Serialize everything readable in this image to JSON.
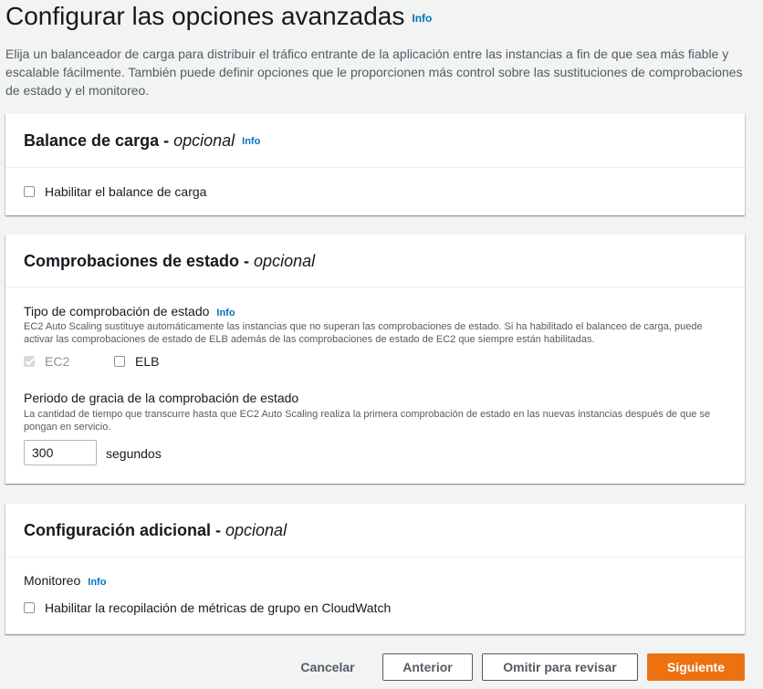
{
  "header": {
    "title": "Configurar las opciones avanzadas",
    "info": "Info",
    "description": "Elija un balanceador de carga para distribuir el tráfico entrante de la aplicación entre las instancias a fin de que sea más fiable y escalable fácilmente. También puede definir opciones que le proporcionen más control sobre las sustituciones de comprobaciones de estado y el monitoreo."
  },
  "load_balancing": {
    "title": "Balance de carga - ",
    "optional": "opcional",
    "info": "Info",
    "checkbox_label": "Habilitar el balance de carga",
    "checked": false
  },
  "health_checks": {
    "title": "Comprobaciones de estado - ",
    "optional": "opcional",
    "type_label": "Tipo de comprobación de estado",
    "info": "Info",
    "type_description": "EC2 Auto Scaling sustituye automáticamente las instancias que no superan las comprobaciones de estado. Si ha habilitado el balanceo de carga, puede activar las comprobaciones de estado de ELB además de las comprobaciones de estado de EC2 que siempre están habilitadas.",
    "options": [
      {
        "label": "EC2",
        "checked": true,
        "disabled": true
      },
      {
        "label": "ELB",
        "checked": false,
        "disabled": false
      }
    ],
    "grace_label": "Periodo de gracia de la comprobación de estado",
    "grace_description": "La cantidad de tiempo que transcurre hasta que EC2 Auto Scaling realiza la primera comprobación de estado en las nuevas instancias después de que se pongan en servicio.",
    "grace_value": "300",
    "grace_unit": "segundos"
  },
  "additional": {
    "title": "Configuración adicional - ",
    "optional": "opcional",
    "monitoring_label": "Monitoreo",
    "info": "Info",
    "checkbox_label": "Habilitar la recopilación de métricas de grupo en CloudWatch",
    "checked": false
  },
  "actions": {
    "cancel": "Cancelar",
    "previous": "Anterior",
    "skip": "Omitir para revisar",
    "next": "Siguiente"
  },
  "colors": {
    "primary": "#ec7211",
    "link": "#0073bb",
    "background": "#f2f3f3"
  }
}
